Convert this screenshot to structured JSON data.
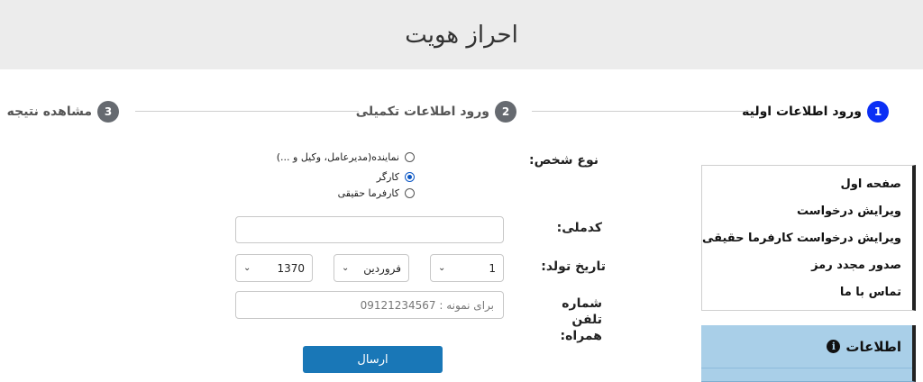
{
  "header": {
    "title": "احراز هویت"
  },
  "stepper": {
    "steps": [
      {
        "number": "1",
        "label": "ورود اطلاعات اولیه"
      },
      {
        "number": "2",
        "label": "ورود اطلاعات تکمیلی"
      },
      {
        "number": "3",
        "label": "مشاهده نتیجه"
      }
    ],
    "active_step": 1
  },
  "form": {
    "person_type": {
      "label": "نوع شخص:",
      "options": [
        "نماینده(مدیرعامل، وکیل و ...)",
        "کارگر",
        "کارفرما حقیقی"
      ],
      "selected": "کارگر"
    },
    "national_code": {
      "label": "کدملی:",
      "value": ""
    },
    "birth_date": {
      "label": "تاریخ تولد:",
      "day": "1",
      "month": "فروردین",
      "year": "1370"
    },
    "phone": {
      "label": "شماره تلفن همراه:",
      "placeholder": "برای نمونه : 09121234567"
    },
    "submit_label": "ارسال"
  },
  "sidebar": {
    "items": [
      "صفحه اول",
      "ویرایش درخواست",
      "ویرایش درخواست کارفرما حقیقی",
      "صدور مجدد رمز",
      "تماس با ما"
    ]
  },
  "info_panel": {
    "title": "اطلاعات",
    "icon": "info-icon"
  },
  "colors": {
    "header_bg": "#ececec",
    "active_step": "#0b2ff5",
    "submit": "#1977b7",
    "info_panel": "#a9cfe8"
  }
}
